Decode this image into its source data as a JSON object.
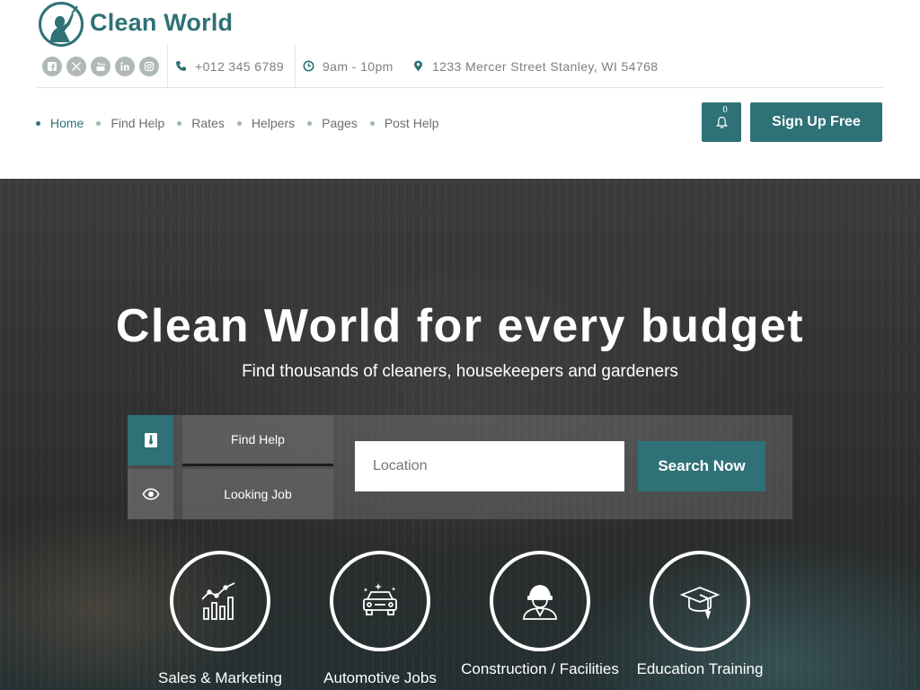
{
  "brand": {
    "name": "Clean World"
  },
  "topbar": {
    "socials": [
      "facebook-icon",
      "twitter-x-icon",
      "youtube-icon",
      "linkedin-icon",
      "instagram-icon"
    ],
    "phone": "+012 345 6789",
    "hours": "9am - 10pm",
    "address": "1233 Mercer Street Stanley, WI 54768"
  },
  "nav": {
    "items": [
      {
        "label": "Home",
        "active": true
      },
      {
        "label": "Find Help"
      },
      {
        "label": "Rates"
      },
      {
        "label": "Helpers"
      },
      {
        "label": "Pages"
      },
      {
        "label": "Post Help"
      }
    ],
    "notifications_count": "0",
    "signup_label": "Sign Up Free"
  },
  "hero": {
    "title": "Clean World for every budget",
    "subtitle": "Find thousands of cleaners, housekeepers and gardeners",
    "tabs": [
      {
        "label": "Find Help",
        "icon": "tie-icon",
        "active": true
      },
      {
        "label": "Looking Job",
        "icon": "eye-icon",
        "active": false
      }
    ],
    "location_placeholder": "Location",
    "search_label": "Search Now"
  },
  "categories": [
    {
      "label": "Sales & Marketing",
      "icon": "chart-growth-icon"
    },
    {
      "label": "Automotive Jobs",
      "icon": "car-icon"
    },
    {
      "label": "Construction / Facilities",
      "icon": "worker-helmet-icon"
    },
    {
      "label": "Education Training",
      "icon": "graduation-cap-icon"
    }
  ],
  "colors": {
    "primary": "#2e7176",
    "nav_text": "#6a6f6f",
    "muted_icon": "#b0b8b8"
  }
}
